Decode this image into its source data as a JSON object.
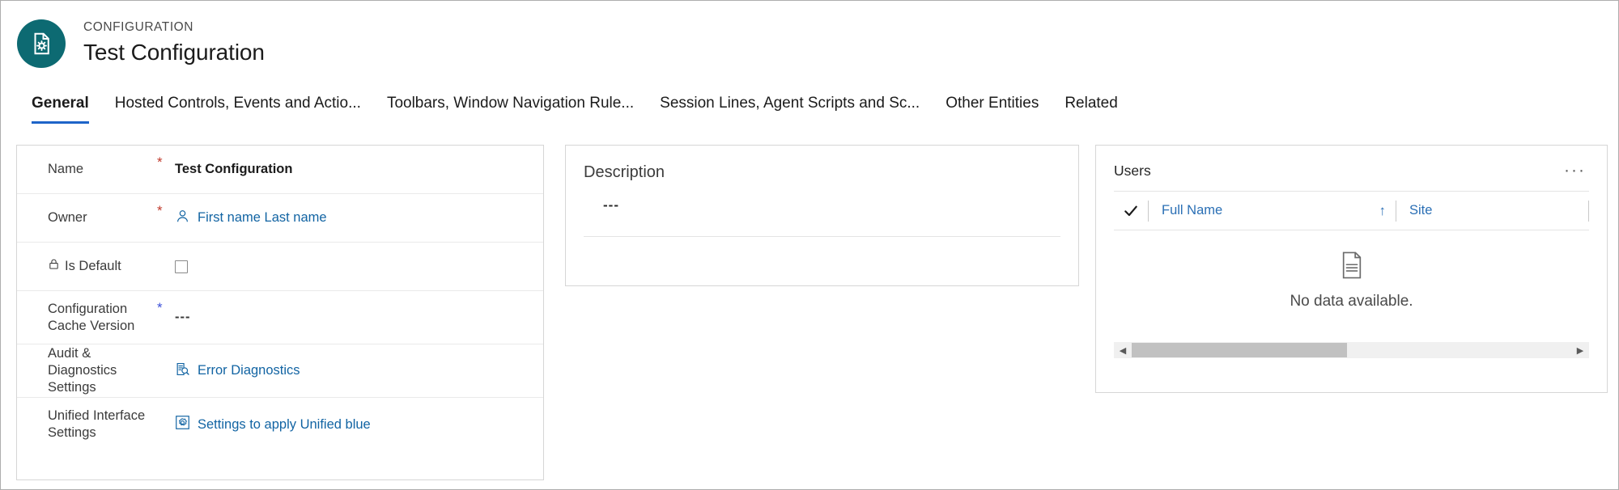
{
  "header": {
    "entity_type": "CONFIGURATION",
    "record_title": "Test Configuration",
    "avatar_icon": "document-gear-icon",
    "avatar_color": "#0d6a72"
  },
  "tabs": [
    {
      "label": "General",
      "active": true
    },
    {
      "label": "Hosted Controls, Events and Actio...",
      "active": false
    },
    {
      "label": "Toolbars, Window Navigation Rule...",
      "active": false
    },
    {
      "label": "Session Lines, Agent Scripts and Sc...",
      "active": false
    },
    {
      "label": "Other Entities",
      "active": false
    },
    {
      "label": "Related",
      "active": false
    }
  ],
  "general": {
    "rows": [
      {
        "label": "Name",
        "required": "*",
        "required_color": "#c0392b",
        "value": "Test Configuration",
        "type": "text"
      },
      {
        "label": "Owner",
        "required": "*",
        "required_color": "#c0392b",
        "value": "First name Last name",
        "type": "lookup",
        "icon": "person-icon"
      },
      {
        "label": "Is Default",
        "required": "",
        "value": "",
        "type": "checkbox",
        "lock_icon": "lock-icon",
        "checked": false
      },
      {
        "label": "Configuration Cache Version",
        "required": "*",
        "required_color": "#3b4fd8",
        "value": "---",
        "type": "placeholder"
      },
      {
        "label": "Audit & Diagnostics Settings",
        "required": "",
        "value": "Error Diagnostics",
        "type": "link",
        "icon": "document-search-icon"
      },
      {
        "label": "Unified Interface Settings",
        "required": "",
        "value": "Settings to apply Unified blue",
        "type": "link",
        "icon": "gear-square-icon"
      }
    ]
  },
  "description": {
    "label": "Description",
    "value": "---"
  },
  "users": {
    "title": "Users",
    "more_label": "···",
    "select_all_icon": "checkmark-icon",
    "columns": [
      {
        "label": "Full Name",
        "sort": "↑"
      },
      {
        "label": "Site",
        "sort": ""
      }
    ],
    "empty_icon": "document-lines-icon",
    "empty_text": "No data available.",
    "scrollbar": {
      "left_arrow": "◀",
      "right_arrow": "▶"
    }
  },
  "colors": {
    "accent_teal": "#0d6a72",
    "link_blue": "#1264a3",
    "tab_underline": "#1e64c8",
    "required_red": "#c0392b",
    "required_blue": "#3b4fd8"
  }
}
